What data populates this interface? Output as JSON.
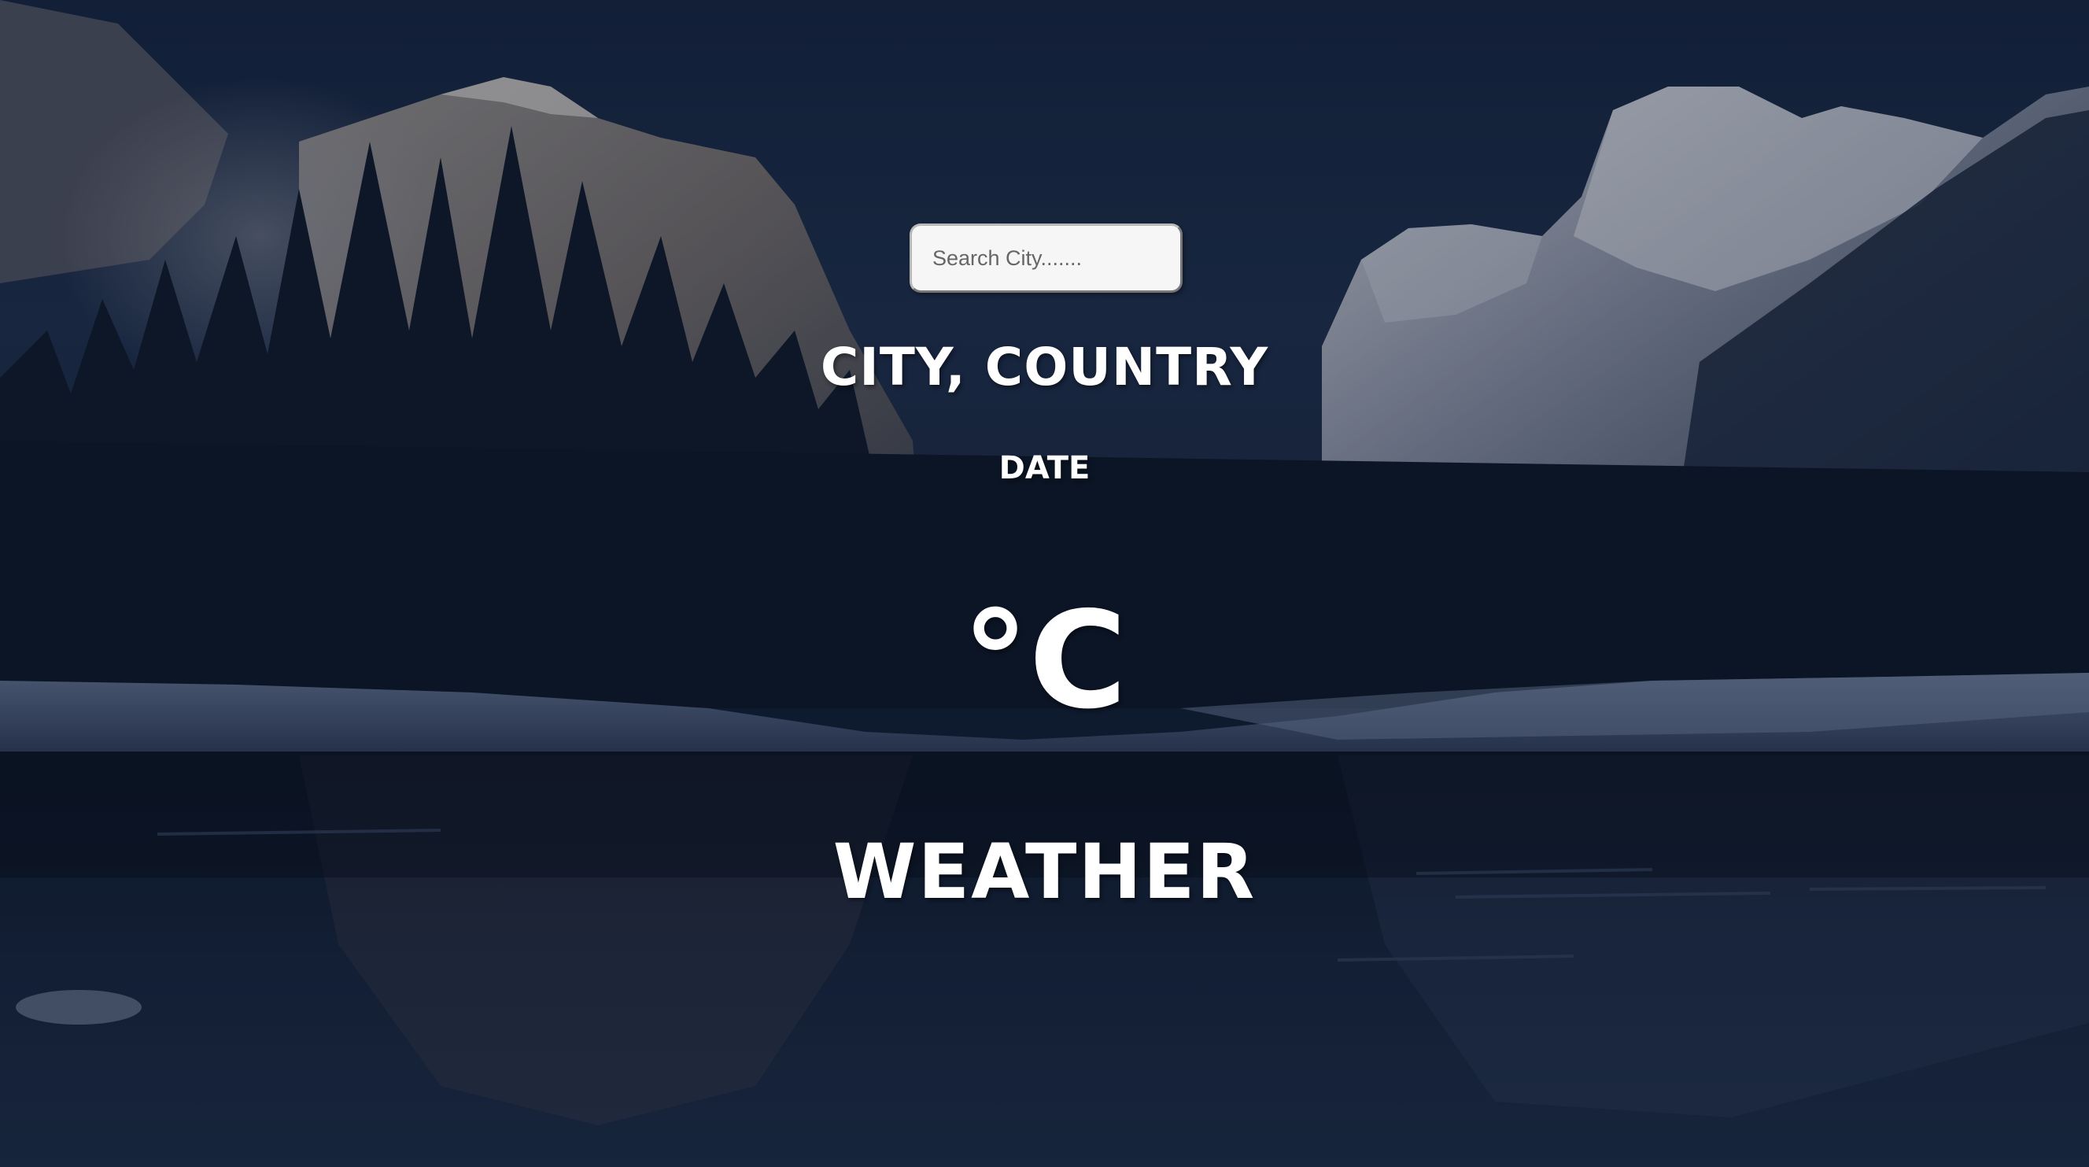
{
  "search": {
    "placeholder": "Search City......."
  },
  "location": {
    "label": "CITY, COUNTRY"
  },
  "date": {
    "label": "DATE"
  },
  "temperature": {
    "value": "",
    "unit": "°C"
  },
  "weather": {
    "label": "WEATHER"
  },
  "colors": {
    "text": "#ffffff",
    "input_bg": "#f6f6f6",
    "overlay": "#0e1a2e"
  }
}
